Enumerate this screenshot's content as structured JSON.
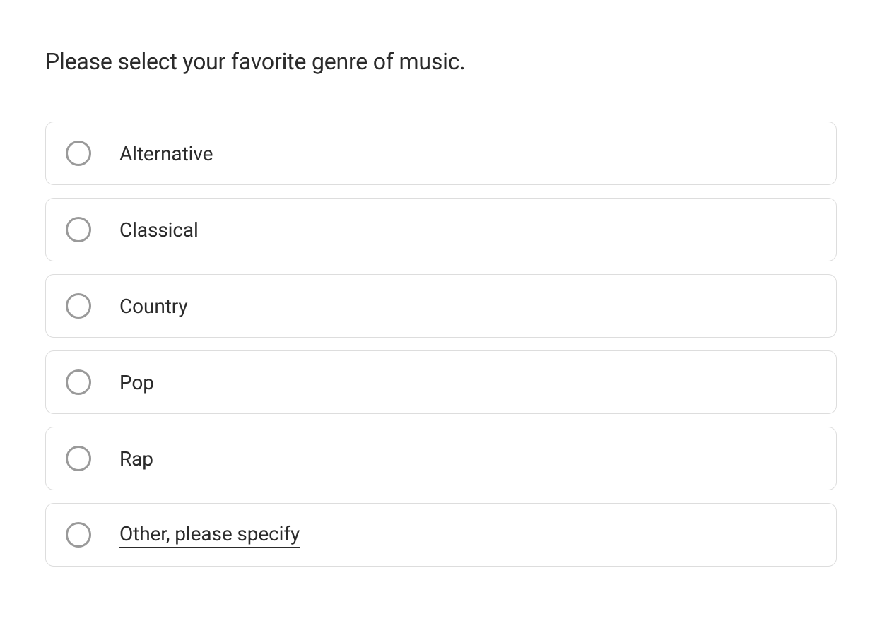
{
  "question": {
    "prompt": "Please select your favorite genre of music.",
    "options": [
      {
        "label": "Alternative",
        "special": false
      },
      {
        "label": "Classical",
        "special": false
      },
      {
        "label": "Country",
        "special": false
      },
      {
        "label": "Pop",
        "special": false
      },
      {
        "label": "Rap",
        "special": false
      },
      {
        "label": "Other, please specify",
        "special": true
      }
    ]
  }
}
